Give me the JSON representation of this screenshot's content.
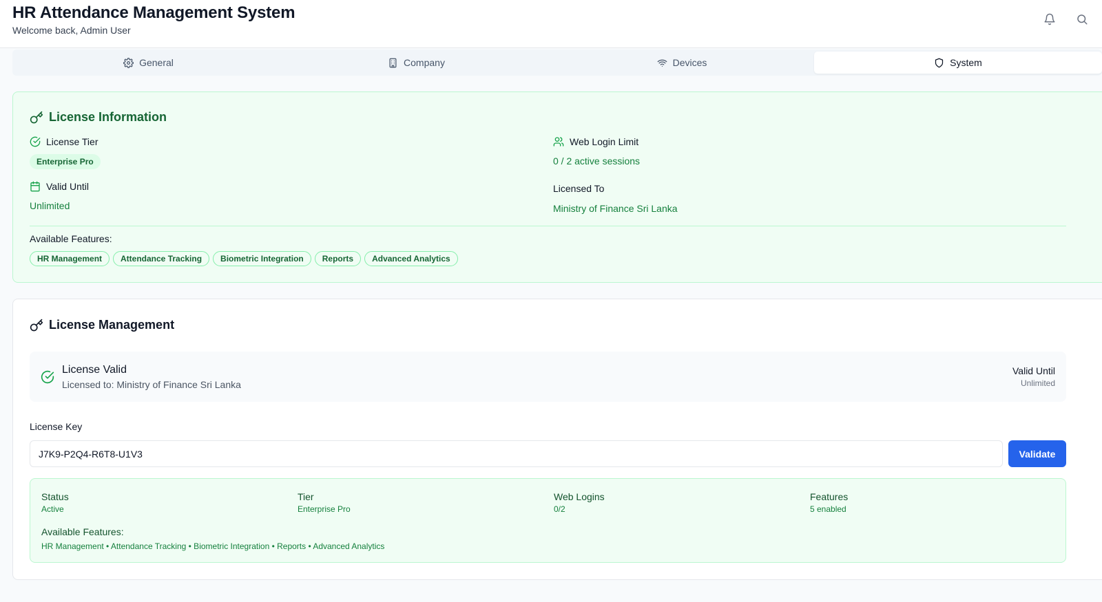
{
  "header": {
    "title": "HR Attendance Management System",
    "subtitle": "Welcome back, Admin User",
    "icons": [
      "bell-icon",
      "search-icon"
    ]
  },
  "tabs": [
    {
      "label": "General",
      "icon": "gear-icon",
      "active": false
    },
    {
      "label": "Company",
      "icon": "building-icon",
      "active": false
    },
    {
      "label": "Devices",
      "icon": "wifi-icon",
      "active": false
    },
    {
      "label": "System",
      "icon": "shield-icon",
      "active": true
    }
  ],
  "license_info": {
    "title": "License Information",
    "tier_label": "License Tier",
    "tier_value": "Enterprise Pro",
    "valid_until_label": "Valid Until",
    "valid_until_value": "Unlimited",
    "web_login_label": "Web Login Limit",
    "web_login_value": "0 / 2 active sessions",
    "licensed_to_label": "Licensed To",
    "licensed_to_value": "Ministry of Finance Sri Lanka",
    "features_label": "Available Features:",
    "features": [
      "HR Management",
      "Attendance Tracking",
      "Biometric Integration",
      "Reports",
      "Advanced Analytics"
    ]
  },
  "license_mgmt": {
    "title": "License Management",
    "status_title": "License Valid",
    "status_sub": "Licensed to: Ministry of Finance Sri Lanka",
    "valid_until_label": "Valid Until",
    "valid_until_value": "Unlimited",
    "key_label": "License Key",
    "key_value": "J7K9-P2Q4-R6T8-U1V3",
    "validate_label": "Validate",
    "summary": {
      "status_label": "Status",
      "status_value": "Active",
      "tier_label": "Tier",
      "tier_value": "Enterprise Pro",
      "web_logins_label": "Web Logins",
      "web_logins_value": "0/2",
      "features_label": "Features",
      "features_value": "5 enabled",
      "available_label": "Available Features:",
      "available_value": "HR Management • Attendance Tracking • Biometric Integration • Reports • Advanced Analytics"
    }
  },
  "colors": {
    "accent": "#2563eb",
    "success": "#15803d",
    "success_bg": "#f0fdf4",
    "success_border": "#bbf7d0"
  }
}
